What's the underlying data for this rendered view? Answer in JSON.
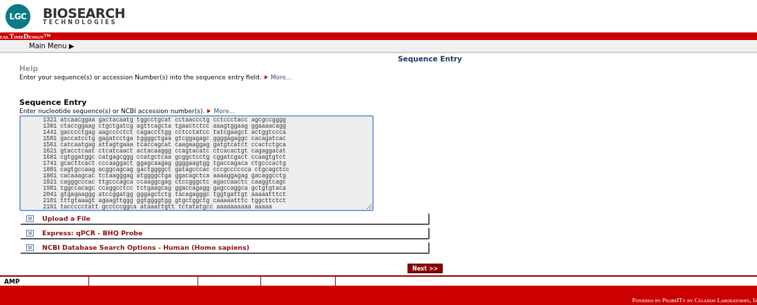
{
  "logo": {
    "badge": "LGC",
    "name": "BIOSEARCH",
    "tagline": "TECHNOLOGIES"
  },
  "app_bar": {
    "title": "ealTimeDesign™"
  },
  "menu": {
    "label": "Main Menu",
    "arrow": "▶"
  },
  "page_title": "Sequence Entry",
  "help": {
    "heading": "Help",
    "text": "Enter your sequence(s) or accession Number(s) into the sequence entry field.",
    "more": "More..."
  },
  "sequence_entry": {
    "heading": "Sequence Entry",
    "text": "Enter nucleotide sequence(s) or NCBI accession number(s).",
    "more": "More...",
    "lines": [
      "      1321 atcaacggaa gactacaatg tggcctgcat cctaaccctg cctccctacc agcgccgggg",
      "      1381 ctaccggaag ctgctgatcg agttcagcta tgaactctcc aaagtggaag ggaaaacagg",
      "      1441 gacccctgag aagcccctct cagaccttgg cctcctatcc tatcgaagct actggtccca",
      "      1501 gaccatcctg gagatcctga tggggctgaa gtcggagagc ggggagaggc cacagatcac",
      "      1561 catcaatgag attagtgaaa tcaccagcat caagaaggag gatgtcatct ccactctgca",
      "      1621 gtacctcaat ctcatcaact actacaaggg ccagtacatc ctcacactgt cagaggacat",
      "      1681 cgtggatggc catgagcggg ccatgctcaa gcggctcctg cggatcgact ccaagtgtct",
      "      1741 gcacttcact cccaaggact ggagcaagag ggggaagtgg tgaccagaca ctgcccactg",
      "      1801 cagtgccaag acggcagcag gactggggct gatagcccac cccgcccccca ctgcagctcc",
      "      1861 cacaaagcac tctaagggag atggggctga ggacagctca aaaaggagag gacaggcctg",
      "      1921 cagggcccac ttgcccagca ccaaggcgag ctccgggctc agaccaactc caaggtcagc",
      "      1981 tggccacagc ccaggcctcc tctgaagcag ggaccagagg gagccaggca gctgtgtaca",
      "      2041 gtgagaaggg atccggatgg gggagctctg tacagagggc tggtgattgt aaaaatttct",
      "      2101 tttgtaaagt agaagttggg ggtggggtgg gtgctggctg caaaaatttc tggcttctct",
      "      2161 taccccctatt gcccccggca ataaattgtt tctatatgcc aaaaaaaaaa aaaaa"
    ]
  },
  "panels": [
    {
      "title": "Upload a File",
      "expanded": false
    },
    {
      "title": "Express: qPCR - BHQ Probe",
      "expanded": false
    },
    {
      "title": "NCBI Database Search Options - Human (Homo sapiens)",
      "expanded": false
    }
  ],
  "next_button": "Next >>",
  "status_row": {
    "label": "AMP"
  },
  "footer": "Powered by ProbeITy by Celadon Laboratories, In"
}
